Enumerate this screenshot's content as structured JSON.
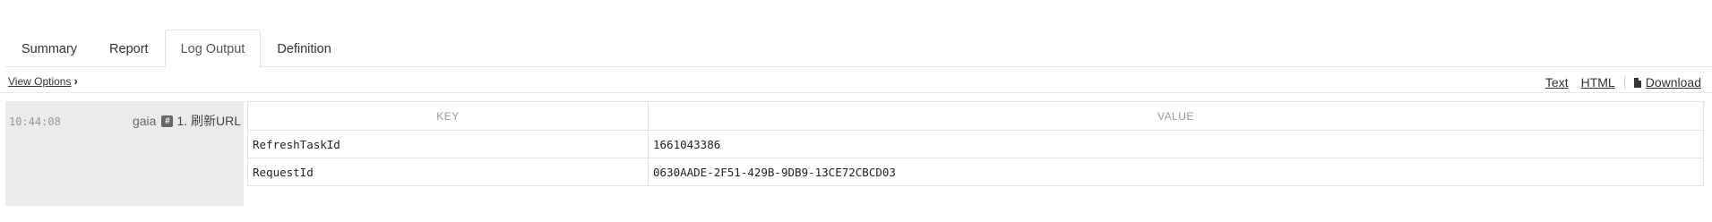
{
  "tabs": [
    {
      "label": "Summary",
      "active": false
    },
    {
      "label": "Report",
      "active": false
    },
    {
      "label": "Log Output",
      "active": true
    },
    {
      "label": "Definition",
      "active": false
    }
  ],
  "toolbar": {
    "view_options": "View Options",
    "text_link": "Text",
    "html_link": "HTML",
    "download_link": "Download"
  },
  "log": {
    "timestamp": "10:44:08",
    "user": "gaia",
    "step": "1. 刷新URL",
    "table": {
      "headers": [
        "KEY",
        "VALUE"
      ],
      "rows": [
        {
          "key": "RefreshTaskId",
          "value": "1661043386"
        },
        {
          "key": "RequestId",
          "value": "0630AADE-2F51-429B-9DB9-13CE72CBCD03"
        }
      ]
    }
  }
}
